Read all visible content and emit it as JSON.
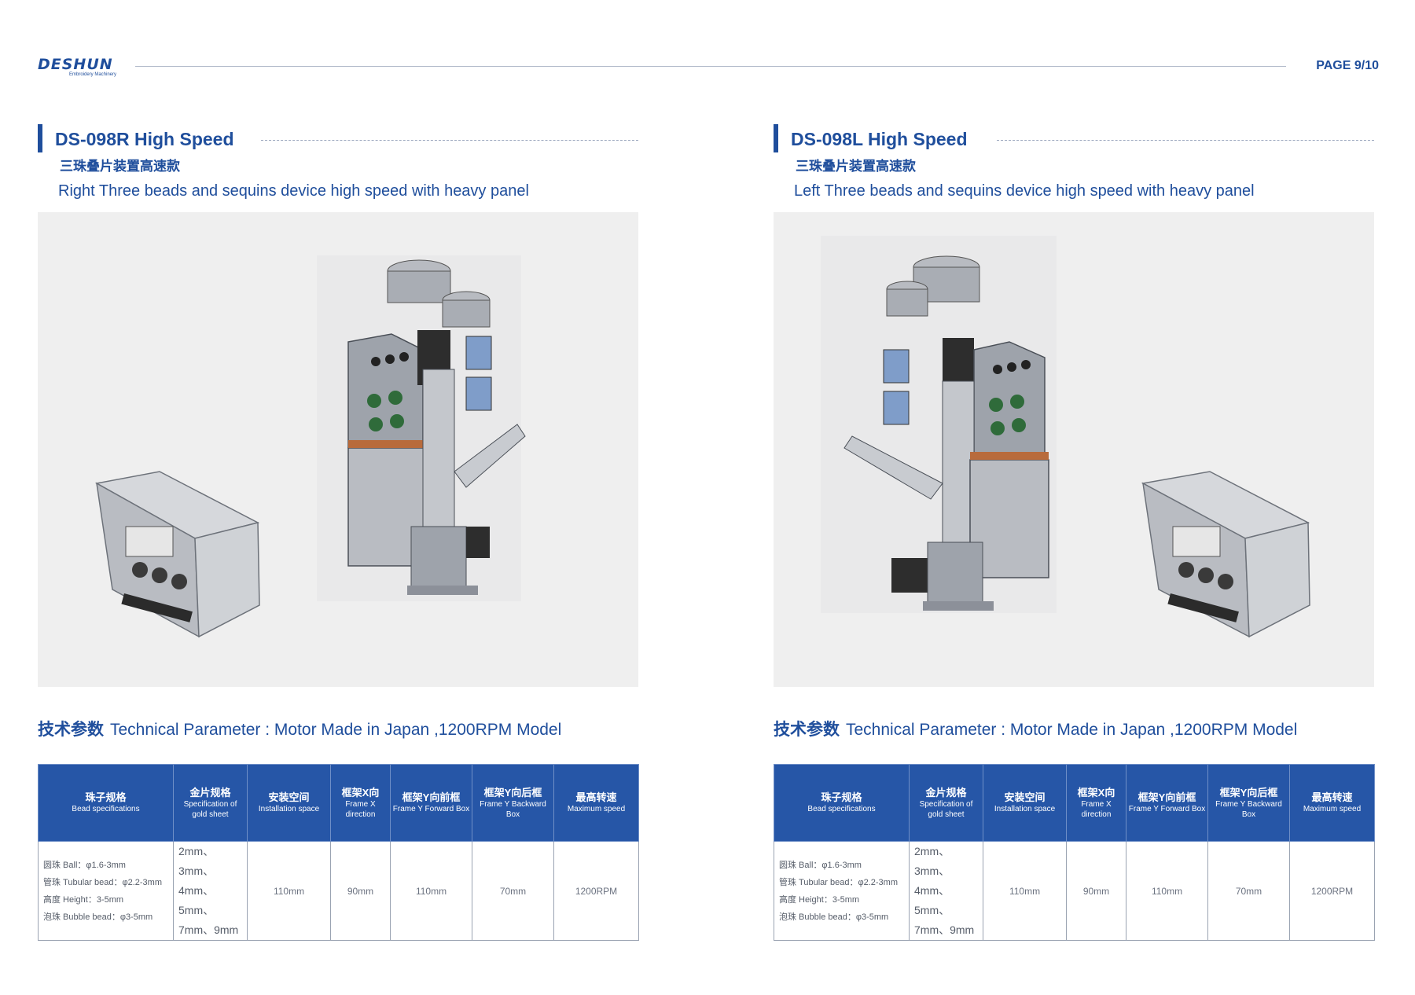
{
  "header": {
    "logo_text": "DESHUN",
    "logo_tagline": "Embroidery Machinery",
    "page_label": "PAGE 9/10"
  },
  "colors": {
    "brand_blue": "#1f4e9c",
    "table_header_bg": "#2656a7",
    "photo_bg": "#efefef"
  },
  "panels": [
    {
      "title": "DS-098R  High Speed",
      "subtitle_cn": "三珠叠片装置高速款",
      "subtitle_en": "Right Three beads and sequins device high speed with heavy panel",
      "tech_title_cn": "技术参数",
      "tech_title_en": "Technical Parameter : Motor Made in Japan ,1200RPM Model",
      "table": {
        "headers": [
          {
            "cn": "珠子规格",
            "en": "Bead specifications"
          },
          {
            "cn": "金片规格",
            "en": "Specification of gold sheet"
          },
          {
            "cn": "安装空间",
            "en": "Installation space"
          },
          {
            "cn": "框架X向",
            "en": "Frame X direction"
          },
          {
            "cn": "框架Y向前框",
            "en": "Frame Y Forward Box"
          },
          {
            "cn": "框架Y向后框",
            "en": "Frame Y Backward Box"
          },
          {
            "cn": "最高转速",
            "en": "Maximum speed"
          }
        ],
        "bead_lines": [
          "圆珠 Ball：φ1.6-3mm",
          "管珠 Tubular bead：φ2.2-3mm",
          "高度 Height：3-5mm",
          "泡珠 Bubble bead：φ3-5mm"
        ],
        "gold_lines": [
          "2mm、3mm、",
          "4mm、5mm、",
          "7mm、9mm"
        ],
        "installation": "110mm",
        "frame_x": "90mm",
        "frame_y_forward": "110mm",
        "frame_y_backward": "70mm",
        "max_speed": "1200RPM"
      }
    },
    {
      "title": "DS-098L  High Speed",
      "subtitle_cn": "三珠叠片装置高速款",
      "subtitle_en": "Left Three beads and sequins device high speed with heavy panel",
      "tech_title_cn": "技术参数",
      "tech_title_en": "Technical Parameter : Motor Made in Japan ,1200RPM Model",
      "table": {
        "headers": [
          {
            "cn": "珠子规格",
            "en": "Bead specifications"
          },
          {
            "cn": "金片规格",
            "en": "Specification of gold sheet"
          },
          {
            "cn": "安装空间",
            "en": "Installation space"
          },
          {
            "cn": "框架X向",
            "en": "Frame X direction"
          },
          {
            "cn": "框架Y向前框",
            "en": "Frame Y Forward Box"
          },
          {
            "cn": "框架Y向后框",
            "en": "Frame Y Backward Box"
          },
          {
            "cn": "最高转速",
            "en": "Maximum speed"
          }
        ],
        "bead_lines": [
          "圆珠 Ball：φ1.6-3mm",
          "管珠 Tubular bead：φ2.2-3mm",
          "高度 Height：3-5mm",
          "泡珠 Bubble bead：φ3-5mm"
        ],
        "gold_lines": [
          "2mm、3mm、",
          "4mm、5mm、",
          "7mm、9mm"
        ],
        "installation": "110mm",
        "frame_x": "90mm",
        "frame_y_forward": "110mm",
        "frame_y_backward": "70mm",
        "max_speed": "1200RPM"
      }
    }
  ]
}
